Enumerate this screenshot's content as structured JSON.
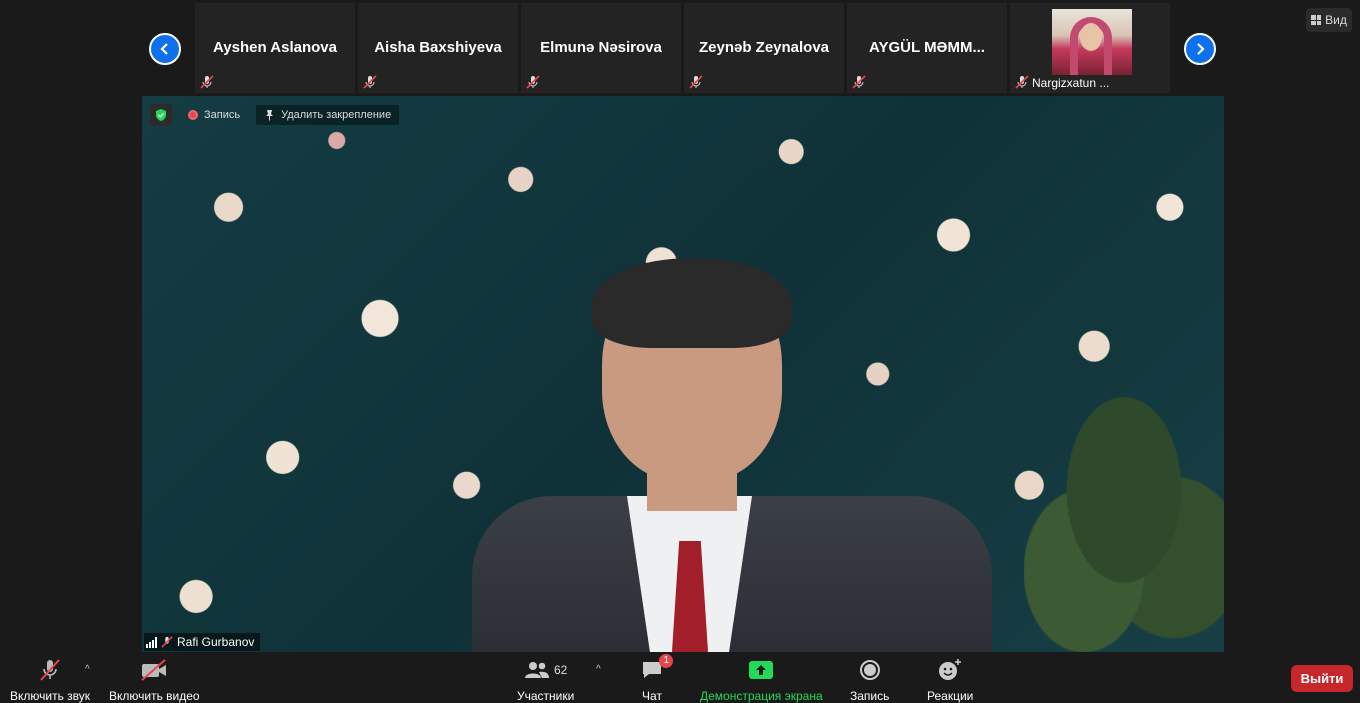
{
  "view_button": {
    "label": "Вид"
  },
  "participants_strip": [
    {
      "name": "Ayshen Aslanova"
    },
    {
      "name": "Aisha Baxshiyeva"
    },
    {
      "name": "Elmunə Nəsirova"
    },
    {
      "name": "Zeynəb Zeynalova"
    },
    {
      "name": "AYGÜL  MƏMM..."
    },
    {
      "name": "Nargizxatun ..."
    }
  ],
  "video_overlay": {
    "record_label": "Запись",
    "unpin_label": "Удалить закрепление"
  },
  "active_speaker": {
    "name": "Rafi Gurbanov"
  },
  "toolbar": {
    "audio_label": "Включить звук",
    "video_label": "Включить видео",
    "participants_label": "Участники",
    "participants_count": "62",
    "chat_label": "Чат",
    "chat_badge": "1",
    "share_label": "Демонстрация экрана",
    "record_label": "Запись",
    "reactions_label": "Реакции",
    "leave_label": "Выйти"
  },
  "colors": {
    "accent_blue": "#0e71eb",
    "share_green": "#23d959",
    "leave_red": "#c7262b",
    "muted_red": "#e8444b"
  }
}
